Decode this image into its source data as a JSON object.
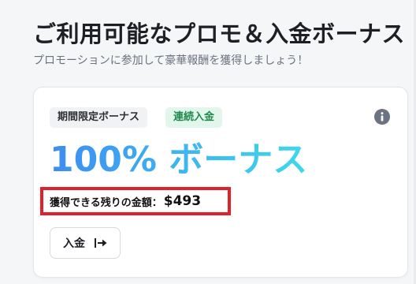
{
  "header": {
    "title": "ご利用可能なプロモ＆入金ボーナス",
    "subtitle": "プロモーションに参加して豪華報酬を獲得しましょう！"
  },
  "promo_card": {
    "badges": [
      "期間限定ボーナス",
      "連続入金"
    ],
    "info_icon": "info-circle-icon",
    "bonus_title": "100% ボーナス",
    "remaining_label": "獲得できる残りの金額：",
    "remaining_amount": "$493",
    "deposit_button_label": "入金",
    "deposit_button_icon": "arrow-right-to-bar-icon"
  },
  "colors": {
    "gradient_start": "#3e8cf0",
    "gradient_end": "#3fd9e8",
    "highlight_border": "#e0202a",
    "green_badge_bg": "#e3f6ec",
    "green_badge_text": "#1f8a4c"
  }
}
